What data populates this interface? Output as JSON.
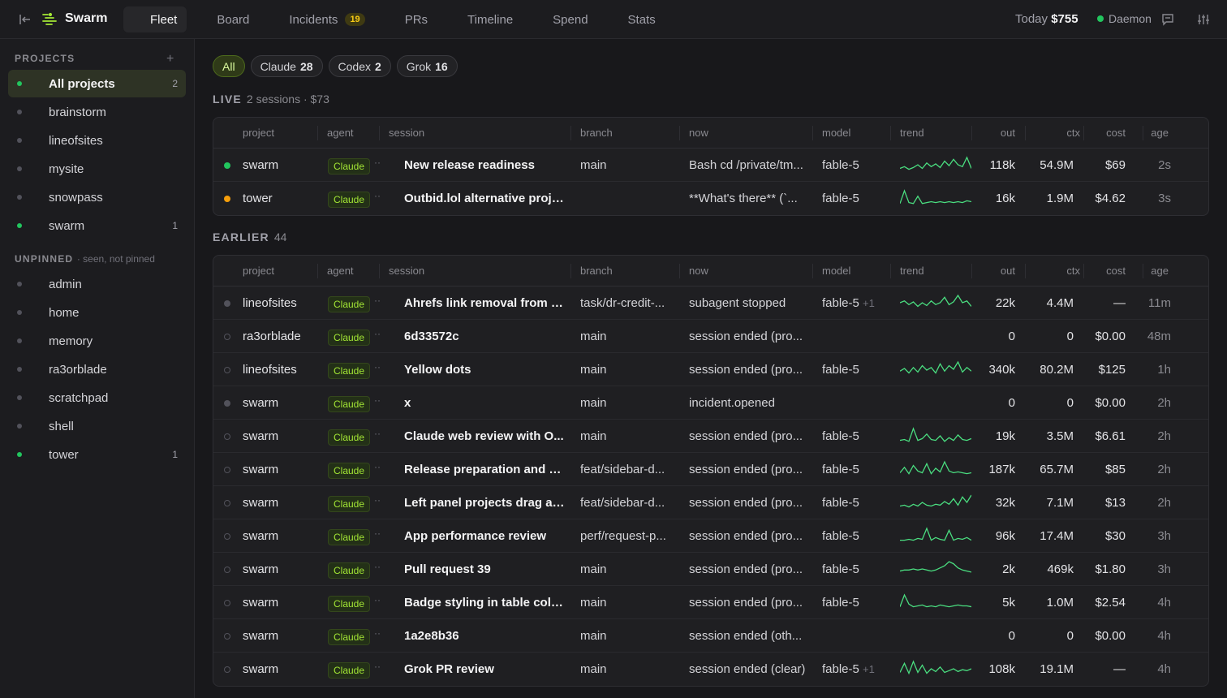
{
  "topbar": {
    "brand": "Swarm",
    "tabs": [
      {
        "label": "Fleet",
        "icon": "grid-icon",
        "active": true
      },
      {
        "label": "Board",
        "icon": "clipboard-icon"
      },
      {
        "label": "Incidents",
        "icon": "incident-icon",
        "count": "19"
      },
      {
        "label": "PRs",
        "icon": "pull-request-icon"
      },
      {
        "label": "Timeline",
        "icon": "clock-icon"
      },
      {
        "label": "Spend",
        "icon": "tag-icon"
      },
      {
        "label": "Stats",
        "icon": "stats-icon"
      }
    ],
    "today_label": "Today",
    "today_value": "$755",
    "daemon_label": "Daemon"
  },
  "sidebar": {
    "projects_header": "PROJECTS",
    "projects": [
      {
        "name": "All projects",
        "count": "2",
        "active": true,
        "on": true
      },
      {
        "name": "brainstorm",
        "count": ""
      },
      {
        "name": "lineofsites",
        "count": ""
      },
      {
        "name": "mysite",
        "count": ""
      },
      {
        "name": "snowpass",
        "count": ""
      },
      {
        "name": "swarm",
        "count": "1",
        "on": true
      }
    ],
    "unpinned_header": "UNPINNED",
    "unpinned_sub": "· seen, not pinned",
    "unpinned": [
      {
        "name": "admin",
        "count": ""
      },
      {
        "name": "home",
        "count": ""
      },
      {
        "name": "memory",
        "count": ""
      },
      {
        "name": "ra3orblade",
        "count": ""
      },
      {
        "name": "scratchpad",
        "count": ""
      },
      {
        "name": "shell",
        "count": ""
      },
      {
        "name": "tower",
        "count": "1",
        "on": true
      }
    ]
  },
  "filters": [
    {
      "label": "All",
      "count": "",
      "active": true
    },
    {
      "label": "Claude",
      "count": "28"
    },
    {
      "label": "Codex",
      "count": "2"
    },
    {
      "label": "Grok",
      "count": "16"
    }
  ],
  "columns": [
    "project",
    "agent",
    "session",
    "branch",
    "now",
    "model",
    "trend",
    "out",
    "ctx",
    "cost",
    "age"
  ],
  "live": {
    "title": "LIVE",
    "summary": "2 sessions · $73",
    "rows": [
      {
        "status": "live",
        "project": "swarm",
        "agent": "Claude",
        "session": "New release readiness",
        "branch": "main",
        "now": "Bash cd /private/tm...",
        "model": "fable-5",
        "extra": "",
        "trend": [
          4,
          6,
          3,
          5,
          8,
          4,
          10,
          6,
          9,
          5,
          12,
          7,
          14,
          8,
          6,
          16,
          4
        ],
        "out": "118k",
        "ctx": "54.9M",
        "cost": "$69",
        "age": "2s"
      },
      {
        "status": "idle",
        "project": "tower",
        "agent": "Claude",
        "session": "Outbid.lol alternative proje...",
        "branch": "",
        "now": "**What's there** (`...",
        "model": "fable-5",
        "extra": "",
        "trend": [
          2,
          16,
          3,
          2,
          10,
          2,
          3,
          4,
          3,
          4,
          3,
          4,
          3,
          4,
          3,
          5,
          4
        ],
        "out": "16k",
        "ctx": "1.9M",
        "cost": "$4.62",
        "age": "3s"
      }
    ]
  },
  "earlier": {
    "title": "EARLIER",
    "count": "44",
    "rows": [
      {
        "status": "gray",
        "project": "lineofsites",
        "agent": "Claude",
        "session": "Ahrefs link removal from D...",
        "branch": "task/dr-credit-...",
        "now": "subagent stopped",
        "model": "fable-5",
        "extra": "+1",
        "trend": [
          8,
          10,
          6,
          9,
          4,
          8,
          5,
          10,
          6,
          8,
          14,
          6,
          9,
          16,
          8,
          10,
          4
        ],
        "out": "22k",
        "ctx": "4.4M",
        "cost": "—",
        "age": "11m"
      },
      {
        "status": "hollow",
        "project": "ra3orblade",
        "agent": "Claude",
        "session": "6d33572c",
        "branch": "main",
        "now": "session ended (pro...",
        "model": "",
        "extra": "",
        "trend": [],
        "out": "0",
        "ctx": "0",
        "cost": "$0.00",
        "age": "48m"
      },
      {
        "status": "hollow",
        "project": "lineofsites",
        "agent": "Claude",
        "session": "Yellow dots",
        "branch": "main",
        "now": "session ended (pro...",
        "model": "fable-5",
        "extra": "",
        "trend": [
          6,
          9,
          4,
          10,
          5,
          12,
          7,
          10,
          4,
          14,
          6,
          12,
          8,
          16,
          5,
          10,
          6
        ],
        "out": "340k",
        "ctx": "80.2M",
        "cost": "$125",
        "age": "1h"
      },
      {
        "status": "gray",
        "project": "swarm",
        "agent": "Claude",
        "session": "x",
        "branch": "main",
        "now": "incident.opened",
        "model": "",
        "extra": "",
        "trend": [],
        "out": "0",
        "ctx": "0",
        "cost": "$0.00",
        "age": "2h"
      },
      {
        "status": "hollow",
        "project": "swarm",
        "agent": "Claude",
        "session": "Claude web review with O...",
        "branch": "main",
        "now": "session ended (pro...",
        "model": "fable-5",
        "extra": "",
        "trend": [
          3,
          4,
          2,
          16,
          3,
          5,
          10,
          4,
          3,
          8,
          2,
          6,
          3,
          9,
          4,
          3,
          5
        ],
        "out": "19k",
        "ctx": "3.5M",
        "cost": "$6.61",
        "age": "2h"
      },
      {
        "status": "hollow",
        "project": "swarm",
        "agent": "Claude",
        "session": "Release preparation and w...",
        "branch": "feat/sidebar-d...",
        "now": "session ended (pro...",
        "model": "fable-5",
        "extra": "",
        "trend": [
          4,
          10,
          3,
          12,
          6,
          4,
          14,
          3,
          9,
          5,
          16,
          6,
          4,
          5,
          4,
          3,
          4
        ],
        "out": "187k",
        "ctx": "65.7M",
        "cost": "$85",
        "age": "2h"
      },
      {
        "status": "hollow",
        "project": "swarm",
        "agent": "Claude",
        "session": "Left panel projects drag an...",
        "branch": "feat/sidebar-d...",
        "now": "session ended (pro...",
        "model": "fable-5",
        "extra": "",
        "trend": [
          4,
          5,
          3,
          6,
          4,
          8,
          5,
          4,
          6,
          5,
          9,
          6,
          12,
          5,
          14,
          8,
          16
        ],
        "out": "32k",
        "ctx": "7.1M",
        "cost": "$13",
        "age": "2h"
      },
      {
        "status": "hollow",
        "project": "swarm",
        "agent": "Claude",
        "session": "App performance review",
        "branch": "perf/request-p...",
        "now": "session ended (pro...",
        "model": "fable-5",
        "extra": "",
        "trend": [
          3,
          3,
          4,
          3,
          5,
          4,
          16,
          3,
          6,
          4,
          3,
          14,
          3,
          5,
          4,
          6,
          3
        ],
        "out": "96k",
        "ctx": "17.4M",
        "cost": "$30",
        "age": "3h"
      },
      {
        "status": "hollow",
        "project": "swarm",
        "agent": "Claude",
        "session": "Pull request 39",
        "branch": "main",
        "now": "session ended (pro...",
        "model": "fable-5",
        "extra": "",
        "trend": [
          5,
          6,
          6,
          7,
          6,
          7,
          6,
          5,
          6,
          8,
          10,
          14,
          12,
          8,
          6,
          5,
          4
        ],
        "out": "2k",
        "ctx": "469k",
        "cost": "$1.80",
        "age": "3h"
      },
      {
        "status": "hollow",
        "project": "swarm",
        "agent": "Claude",
        "session": "Badge styling in table colu...",
        "branch": "main",
        "now": "session ended (pro...",
        "model": "fable-5",
        "extra": "",
        "trend": [
          3,
          16,
          6,
          3,
          4,
          5,
          3,
          4,
          3,
          5,
          4,
          3,
          4,
          5,
          4,
          4,
          3
        ],
        "out": "5k",
        "ctx": "1.0M",
        "cost": "$2.54",
        "age": "4h"
      },
      {
        "status": "hollow",
        "project": "swarm",
        "agent": "Claude",
        "session": "1a2e8b36",
        "branch": "main",
        "now": "session ended (oth...",
        "model": "",
        "extra": "",
        "trend": [],
        "out": "0",
        "ctx": "0",
        "cost": "$0.00",
        "age": "4h"
      },
      {
        "status": "hollow",
        "project": "swarm",
        "agent": "Claude",
        "session": "Grok PR review",
        "branch": "main",
        "now": "session ended (clear)",
        "model": "fable-5",
        "extra": "+1",
        "trend": [
          4,
          14,
          3,
          16,
          4,
          12,
          3,
          8,
          5,
          10,
          4,
          6,
          8,
          5,
          7,
          6,
          8
        ],
        "out": "108k",
        "ctx": "19.1M",
        "cost": "—",
        "age": "4h"
      }
    ]
  },
  "colors": {
    "accent": "#a3e635",
    "live": "#22c55e",
    "idle": "#f59e0b"
  }
}
